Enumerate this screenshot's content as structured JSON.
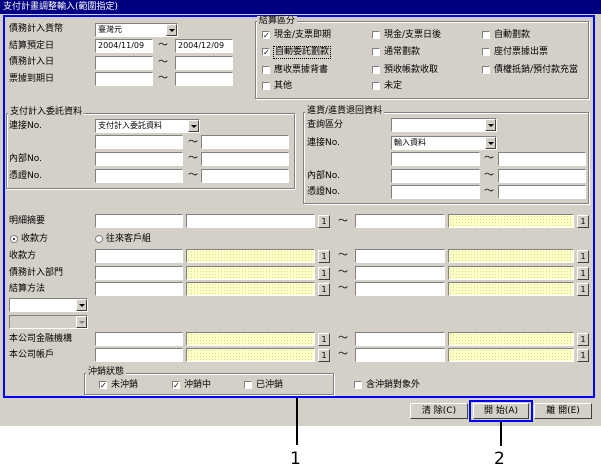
{
  "window": {
    "title": "支付計畫調整輸入(範圍指定)"
  },
  "top_fields": {
    "currency_label": "債務計入貨幣",
    "currency_value": "臺灣元",
    "settle_date_label": "結算預定日",
    "settle_date_from": "2004/11/09",
    "settle_date_to": "2004/12/09",
    "debt_date_label": "債務計入日",
    "bill_due_label": "票據到期日",
    "tilde": "～"
  },
  "settlement_type": {
    "title": "結算區分",
    "items": [
      {
        "label": "現金/支票即期",
        "checked": true
      },
      {
        "label": "現金/支票日後",
        "checked": false
      },
      {
        "label": "自動劃款",
        "checked": false
      },
      {
        "label": "自動委託劃款",
        "checked": true
      },
      {
        "label": "通常劃款",
        "checked": false
      },
      {
        "label": "座付票據出票",
        "checked": false
      },
      {
        "label": "應收票據背書",
        "checked": false
      },
      {
        "label": "預收帳款收取",
        "checked": false
      },
      {
        "label": "債權抵銷/預付款充當",
        "checked": false
      },
      {
        "label": "其他",
        "checked": false
      },
      {
        "label": "未定",
        "checked": false
      }
    ]
  },
  "payment_plan": {
    "title": "支付計入委託資料",
    "link_no_label": "連接No.",
    "link_no_value": "支付計入委託資料",
    "internal_no_label": "內部No.",
    "voucher_no_label": "憑證No."
  },
  "purchase_return": {
    "title": "進貨/進貨退回資料",
    "query_type_label": "查詢區分",
    "query_type_value": "",
    "link_no_label": "連接No.",
    "link_no_value": "輸入資料",
    "internal_no_label": "內部No.",
    "voucher_no_label": "憑證No."
  },
  "details": {
    "summary_label": "明細摘要",
    "radio_payee": "收款方",
    "radio_customer_group": "往來客戶組",
    "payee_label": "收款方",
    "debt_dept_label": "債務計入部門",
    "method_label": "結算方法",
    "bank_label": "本公司金融機構",
    "account_label": "本公司帳戶",
    "one_btn": "1"
  },
  "offset_status": {
    "title": "沖銷狀態",
    "not_offset": "未沖銷",
    "not_offset_checked": true,
    "offsetting": "沖銷中",
    "offsetting_checked": true,
    "offset_done": "已沖銷",
    "offset_done_checked": false,
    "exclude_label": "含沖銷對象外",
    "exclude_checked": false
  },
  "buttons": {
    "clear": "清 除(C)",
    "start": "開 始(A)",
    "close": "離 開(E)"
  },
  "callouts": {
    "one": "1",
    "two": "2"
  },
  "colors": {
    "title_bar": "#000080",
    "highlight": "#0000ff",
    "face": "#d4d0c8",
    "yellow_field": "#ffffc8"
  }
}
